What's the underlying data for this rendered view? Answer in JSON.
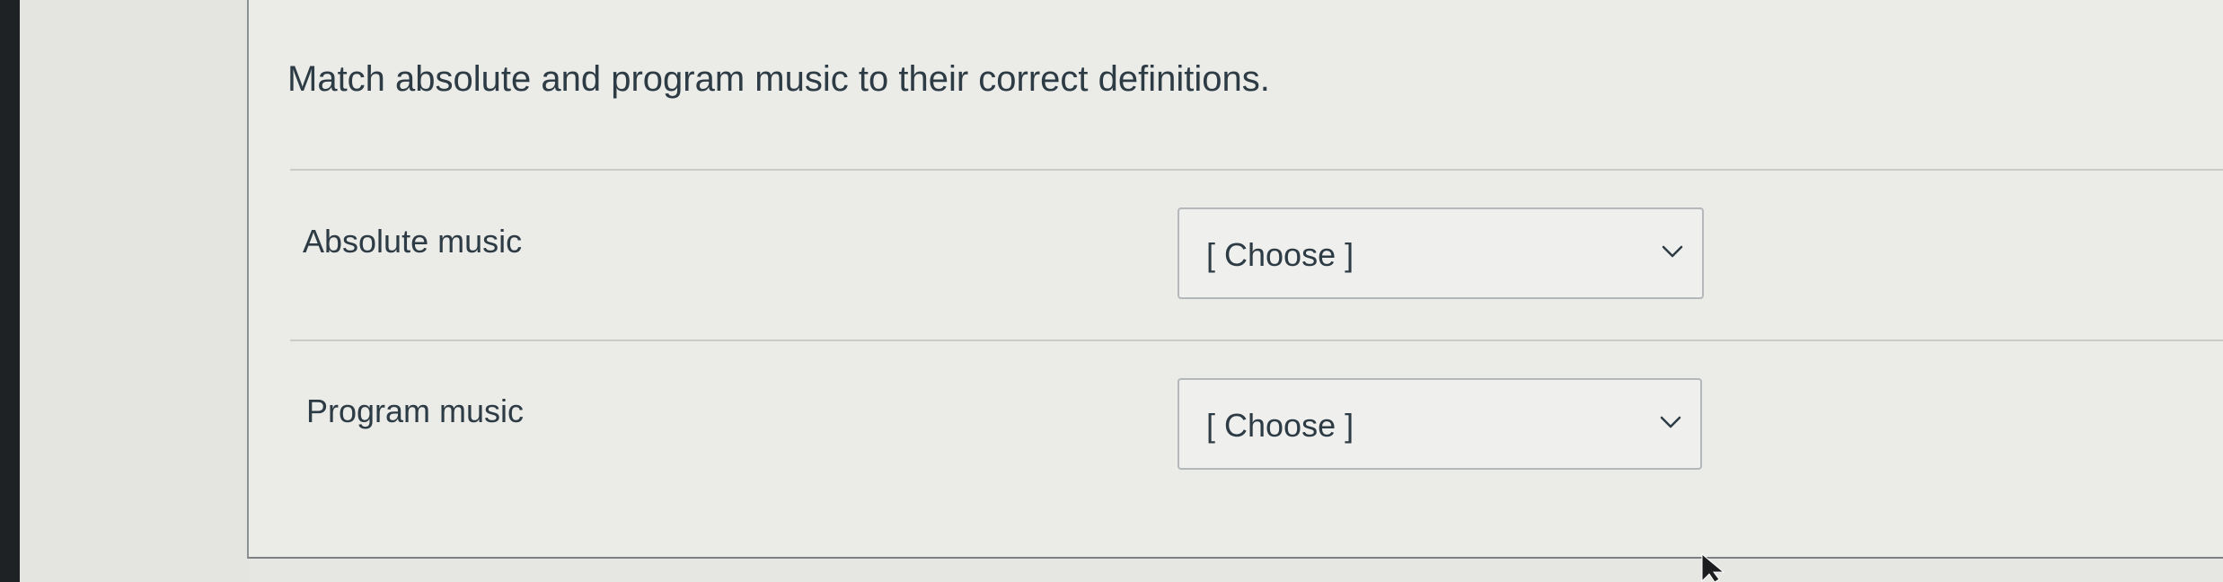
{
  "question": {
    "prompt": "Match absolute and program music to their correct definitions."
  },
  "matches": [
    {
      "label": "Absolute music",
      "selected": "[ Choose ]"
    },
    {
      "label": "Program music",
      "selected": "[ Choose ]"
    }
  ],
  "icons": {
    "dropdown": "chevron-down-icon",
    "pointer": "mouse-cursor-icon"
  },
  "colors": {
    "text": "#2d3b45",
    "panel_background": "#ebebe8",
    "select_border": "#b4b8bb"
  }
}
